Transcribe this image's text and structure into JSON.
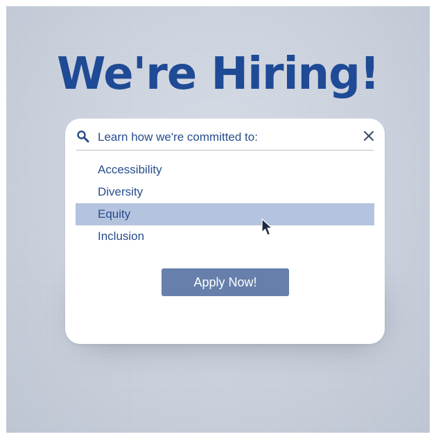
{
  "headline": "We're Hiring!",
  "search": {
    "label": "Learn how we're committed to:",
    "icon": "search-icon",
    "close_icon": "close-icon"
  },
  "options": [
    {
      "label": "Accessibility",
      "selected": false
    },
    {
      "label": "Diversity",
      "selected": false
    },
    {
      "label": "Equity",
      "selected": true
    },
    {
      "label": "Inclusion",
      "selected": false
    }
  ],
  "apply_button": {
    "label": "Apply Now!"
  },
  "cursor_icon": "arrow-cursor-icon",
  "colors": {
    "headline": "#1f4a95",
    "text": "#264c8c",
    "selected_row": "#b5c4de",
    "button": "#6680ab",
    "button_text": "#ffffff",
    "background": "#ccd3df",
    "close_icon": "#3a4a66"
  }
}
